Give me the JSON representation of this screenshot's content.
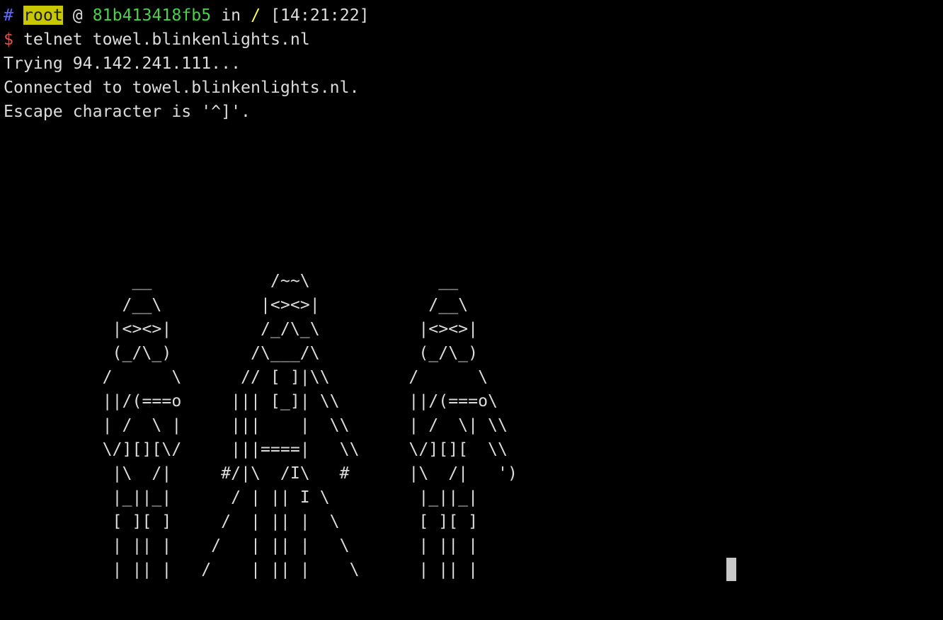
{
  "prompt": {
    "hash": "#",
    "user": "root",
    "at": "@",
    "host": "81b413418fb5",
    "in": "in",
    "cwd": "/",
    "time": "[14:21:22]"
  },
  "command": {
    "symbol": "$",
    "text": "telnet towel.blinkenlights.nl"
  },
  "output": [
    "Trying 94.142.241.111...",
    "Connected to towel.blinkenlights.nl.",
    "Escape character is '^]'."
  ],
  "ascii_art": [
    "                                         ",
    "             __            /~~\\             __",
    "            /__\\          |<><>|           /__\\",
    "           |<><>|         /_/\\_\\          |<><>|",
    "           (_/\\_)        /\\___/\\          (_/\\_)",
    "          /      \\      // [ ]|\\\\        /      \\",
    "          ||/(===o     ||| [_]| \\\\       ||/(===o\\",
    "          | /  \\ |     |||    |  \\\\      | /  \\| \\\\",
    "          \\/][][\\/     |||====|   \\\\     \\/][][  \\\\",
    "           |\\  /|     #/|\\  /I\\   #      |\\  /|   ')",
    "           |_||_|      / | || I \\         |_||_|",
    "           [ ][ ]     /  | || |  \\        [ ][ ]",
    "           | || |    /   | || |   \\       | || |",
    "           | || |   /    | || |    \\      | || |"
  ]
}
